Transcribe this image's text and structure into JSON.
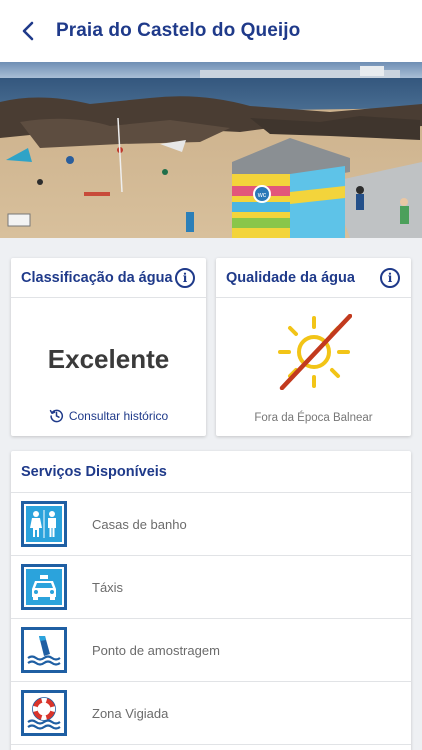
{
  "header": {
    "title": "Praia do Castelo do Queijo",
    "back_icon": "chevron-left-icon"
  },
  "hero": {
    "description_icon": "beach-photo"
  },
  "water_classification": {
    "title": "Classificação da água",
    "value": "Excelente",
    "history_link": "Consultar histórico"
  },
  "water_quality": {
    "title": "Qualidade da água",
    "status": "Fora da Época Balnear"
  },
  "services": {
    "title": "Serviços Disponíveis",
    "items": [
      {
        "label": "Casas de banho",
        "icon": "restroom-icon"
      },
      {
        "label": "Táxis",
        "icon": "taxi-icon"
      },
      {
        "label": "Ponto de amostragem",
        "icon": "sampling-point-icon"
      },
      {
        "label": "Zona Vigiada",
        "icon": "lifebuoy-icon"
      }
    ]
  },
  "colors": {
    "primary": "#1f3a8a",
    "icon_border": "#1f5fa3",
    "icon_fill": "#2ba3dc",
    "sun": "#f2c417",
    "strike": "#c23a1e"
  }
}
